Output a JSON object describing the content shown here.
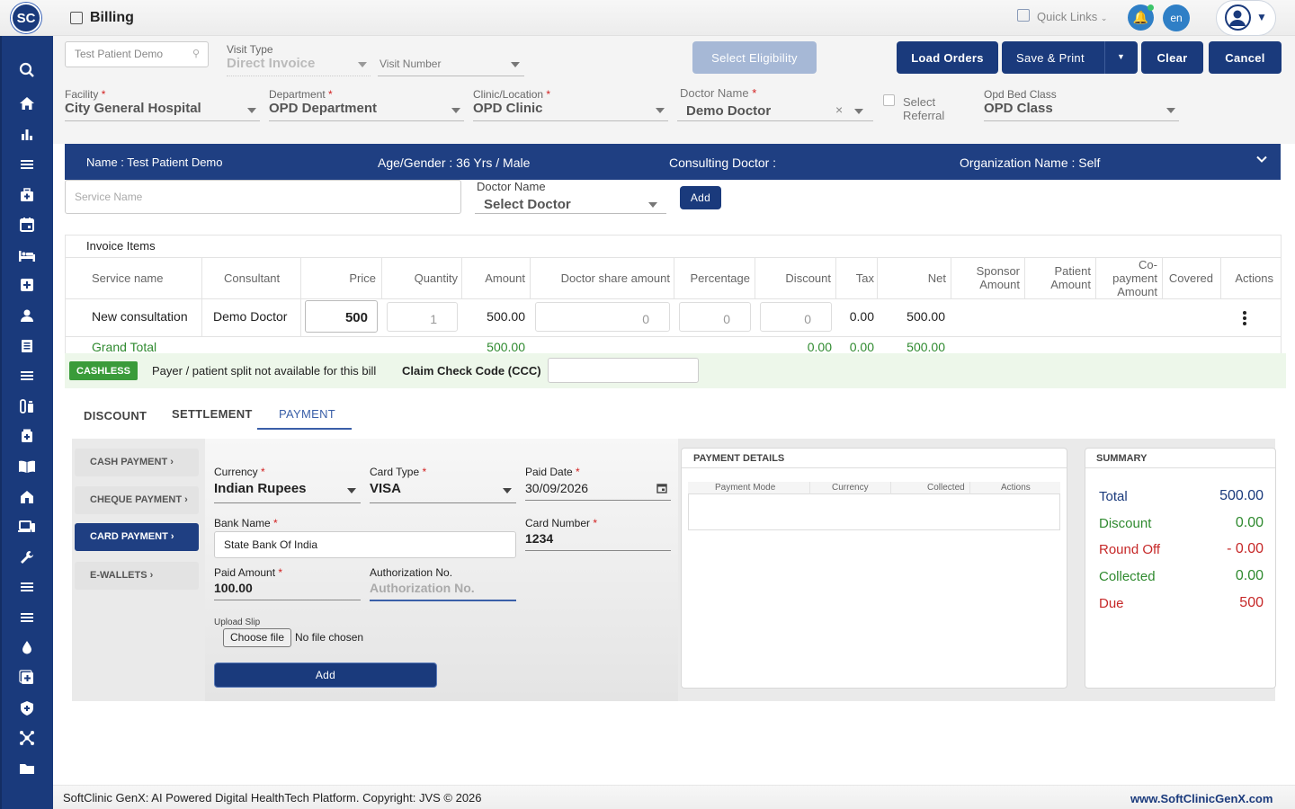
{
  "app": {
    "logo_text": "SC",
    "title": "Billing"
  },
  "topbar": {
    "quick_links": "Quick Links",
    "lang": "en"
  },
  "header": {
    "patient_search": "Test Patient Demo",
    "visit_type_label": "Visit Type",
    "visit_type_value": "Direct Invoice",
    "visit_number_placeholder": "Visit Number",
    "select_eligibility": "Select Eligibility",
    "load_orders": "Load Orders",
    "save_print": "Save & Print",
    "clear": "Clear",
    "cancel": "Cancel",
    "facility_label": "Facility",
    "facility_value": "City General Hospital",
    "department_label": "Department",
    "department_value": "OPD Department",
    "clinic_label": "Clinic/Location",
    "clinic_value": "OPD Clinic",
    "doctor_label": "Doctor Name",
    "doctor_value": "Demo Doctor",
    "select_referral": "Select Referral",
    "bed_class_label": "Opd Bed Class",
    "bed_class_value": "OPD Class"
  },
  "banner": {
    "name": "Name :  Test Patient Demo",
    "age_gender": "Age/Gender :  36 Yrs / Male",
    "consulting": "Consulting Doctor :",
    "organization": "Organization Name :  Self"
  },
  "service": {
    "placeholder": "Service Name",
    "doctor_label": "Doctor Name",
    "doctor_value": "Select Doctor",
    "add": "Add"
  },
  "invoice": {
    "title": "Invoice Items",
    "columns": [
      "Service name",
      "Consultant",
      "Price",
      "Quantity",
      "Amount",
      "Doctor share amount",
      "Percentage",
      "Discount",
      "Tax",
      "Net",
      "Sponsor Amount",
      "Patient Amount",
      "Co-payment Amount",
      "Covered",
      "Actions"
    ],
    "row": {
      "service": "New consultation",
      "consultant": "Demo Doctor",
      "price": "500",
      "quantity": "1",
      "amount": "500.00",
      "doctor_share": "0",
      "percentage": "0",
      "discount": "0",
      "tax": "0.00",
      "net": "500.00"
    },
    "grand_total": {
      "label": "Grand Total",
      "amount": "500.00",
      "discount": "0.00",
      "tax": "0.00",
      "net": "500.00"
    }
  },
  "cashless": {
    "badge": "CASHLESS",
    "message": "Payer / patient split not available for this bill",
    "ccc_label": "Claim Check Code (CCC)"
  },
  "tabs": [
    "DISCOUNT",
    "SETTLEMENT",
    "PAYMENT"
  ],
  "payment_methods": [
    "CASH PAYMENT ›",
    "CHEQUE PAYMENT ›",
    "CARD PAYMENT ›",
    "E-WALLETS ›"
  ],
  "payment_form": {
    "currency_label": "Currency",
    "currency_value": "Indian Rupees",
    "card_type_label": "Card Type",
    "card_type_value": "VISA",
    "paid_date_label": "Paid Date",
    "paid_date_value": "30/09/2026",
    "bank_name_label": "Bank Name",
    "bank_name_value": "State Bank Of India",
    "card_number_label": "Card Number",
    "card_number_value": "1234",
    "paid_amount_label": "Paid Amount",
    "paid_amount_value": "100.00",
    "auth_label": "Authorization No.",
    "auth_placeholder": "Authorization No.",
    "upload_label": "Upload Slip",
    "choose_file": "Choose file",
    "no_file": "No file chosen",
    "add": "Add"
  },
  "payment_details": {
    "title": "PAYMENT DETAILS",
    "columns": [
      "Payment Mode",
      "Currency",
      "Collected",
      "Actions"
    ]
  },
  "summary": {
    "title": "SUMMARY",
    "rows": [
      {
        "label": "Total",
        "value": "500.00",
        "color": "#1a3a7c"
      },
      {
        "label": "Discount",
        "value": "0.00",
        "color": "#2f8a2f"
      },
      {
        "label": "Round Off",
        "value": "- 0.00",
        "color": "#c62828"
      },
      {
        "label": "Collected",
        "value": "0.00",
        "color": "#2f8a2f"
      },
      {
        "label": "Due",
        "value": "500",
        "color": "#c62828"
      }
    ]
  },
  "footer": {
    "text": "SoftClinic GenX: AI Powered Digital HealthTech Platform. Copyright: JVS © 2026",
    "link": "www.SoftClinicGenX.com"
  },
  "colors": {
    "brand": "#1a3a7c",
    "green": "#2f8a2f",
    "red": "#c62828"
  },
  "sidebar_icons": [
    "search-icon",
    "home-icon",
    "bar-chart-icon",
    "menu-icon",
    "medical-bag-icon",
    "calendar-icon",
    "bed-icon",
    "plus-box-icon",
    "person-icon",
    "document-icon",
    "menu-icon",
    "vial-icon",
    "pill-icon",
    "book-icon",
    "building-icon",
    "devices-icon",
    "wrench-icon",
    "menu-icon",
    "menu-icon",
    "drop-icon",
    "add-doc-icon",
    "shield-icon",
    "network-icon",
    "folder-icon"
  ]
}
